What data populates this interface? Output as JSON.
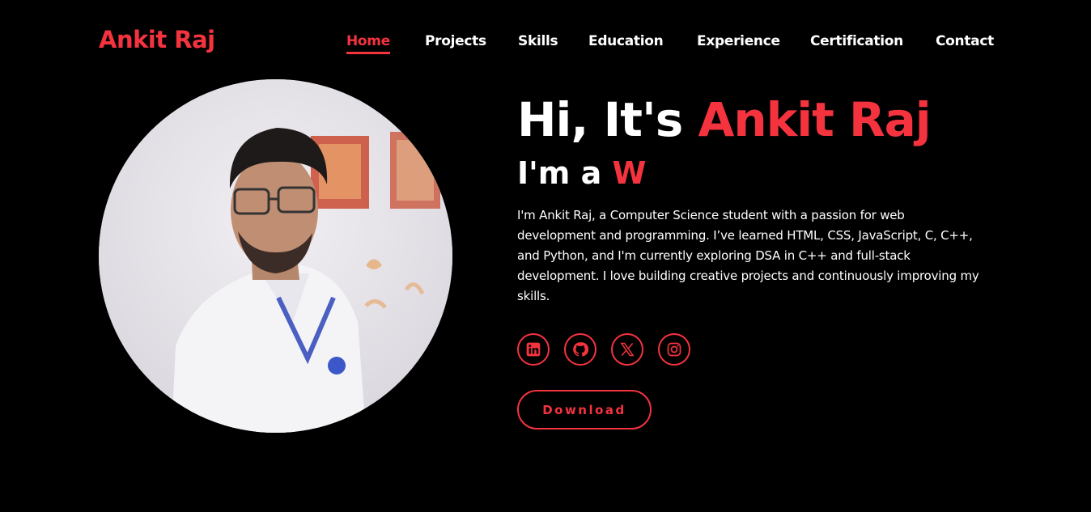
{
  "header": {
    "logo": "Ankit Raj",
    "nav": [
      {
        "label": "Home",
        "active": true
      },
      {
        "label": "Projects",
        "active": false
      },
      {
        "label": "Skills",
        "active": false
      },
      {
        "label": "Education",
        "active": false
      },
      {
        "label": "Experience",
        "active": false
      },
      {
        "label": "Certification",
        "active": false
      },
      {
        "label": "Contact",
        "active": false
      }
    ]
  },
  "hero": {
    "greeting": "Hi, It's",
    "name": "Ankit Raj",
    "role_prefix": "I'm a",
    "role_typed": "W",
    "bio": "I'm Ankit Raj, a Computer Science student with a passion for web development and programming. I’ve learned HTML, CSS, JavaScript, C, C++, and Python, and I'm currently exploring DSA in C++ and full-stack development. I love building creative projects and continuously improving my skills.",
    "socials": [
      {
        "icon": "linkedin-icon"
      },
      {
        "icon": "github-icon"
      },
      {
        "icon": "x-twitter-icon"
      },
      {
        "icon": "instagram-icon"
      }
    ],
    "download_label": "Download"
  },
  "colors": {
    "accent": "#f5333f",
    "background": "#000000",
    "text": "#ffffff"
  }
}
